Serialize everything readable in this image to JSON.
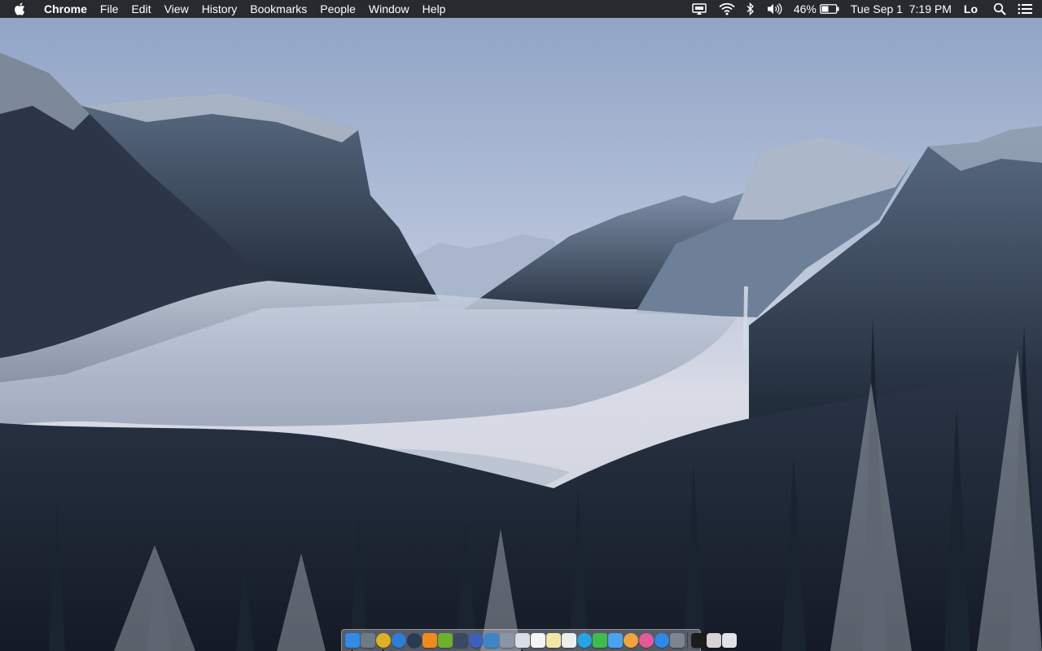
{
  "menubar": {
    "apple_icon": "apple-logo-icon",
    "app_name": "Chrome",
    "menus": [
      "File",
      "Edit",
      "View",
      "History",
      "Bookmarks",
      "People",
      "Window",
      "Help"
    ],
    "status": {
      "airplay_icon": "airplay-display-icon",
      "wifi_icon": "wifi-icon",
      "bluetooth_icon": "bluetooth-icon",
      "volume_icon": "volume-icon",
      "battery_percent": "46%",
      "battery_icon": "battery-icon",
      "datetime": "Tue Sep 1  7:19 PM",
      "user": "Lo",
      "spotlight_icon": "search-icon",
      "notification_center_icon": "list-icon"
    }
  },
  "desktop": {
    "wallpaper": "Yosemite valley with fog and snow-covered mountains"
  },
  "dock": {
    "apps": [
      {
        "name": "finder-icon",
        "color": "#2f8be6",
        "running": true
      },
      {
        "name": "launchpad-icon",
        "color": "#6f7a88",
        "running": false
      },
      {
        "name": "chrome-icon",
        "color": "#e0b023",
        "running": true
      },
      {
        "name": "safari-icon",
        "color": "#2c7ed6",
        "running": false
      },
      {
        "name": "steam-icon",
        "color": "#2a3a4f",
        "running": false
      },
      {
        "name": "vlc-icon",
        "color": "#f08a1c",
        "running": false
      },
      {
        "name": "utorrent-icon",
        "color": "#6cb02e",
        "running": false
      },
      {
        "name": "tunnelblick-icon",
        "color": "#3b4a60",
        "running": false
      },
      {
        "name": "browser-globe-icon",
        "color": "#3f5fbf",
        "running": false
      },
      {
        "name": "xcode-icon",
        "color": "#3a86c8",
        "running": false
      },
      {
        "name": "preview-icon",
        "color": "#8a94a4",
        "running": false
      },
      {
        "name": "photo-viewer-icon",
        "color": "#d8dde6",
        "running": true
      },
      {
        "name": "calendar-icon",
        "color": "#f4f4f4",
        "running": false
      },
      {
        "name": "notes-icon",
        "color": "#f3e6a4",
        "running": false
      },
      {
        "name": "reminders-icon",
        "color": "#eeeeee",
        "running": false
      },
      {
        "name": "skype-icon",
        "color": "#23a6e0",
        "running": false
      },
      {
        "name": "facetime-icon",
        "color": "#3cbd4a",
        "running": false
      },
      {
        "name": "messages-icon",
        "color": "#4aa3f2",
        "running": false
      },
      {
        "name": "photos-icon",
        "color": "#f0a43a",
        "running": false
      },
      {
        "name": "itunes-icon",
        "color": "#e55a9a",
        "running": false
      },
      {
        "name": "app-store-icon",
        "color": "#2d8ae8",
        "running": false
      },
      {
        "name": "system-preferences-icon",
        "color": "#7d8591",
        "running": false
      }
    ],
    "right_items": [
      {
        "name": "terminal-icon",
        "color": "#1c1c1c"
      },
      {
        "name": "document-stack-icon",
        "color": "#d9d2d2"
      },
      {
        "name": "trash-icon",
        "color": "#dfe3e8"
      }
    ]
  }
}
